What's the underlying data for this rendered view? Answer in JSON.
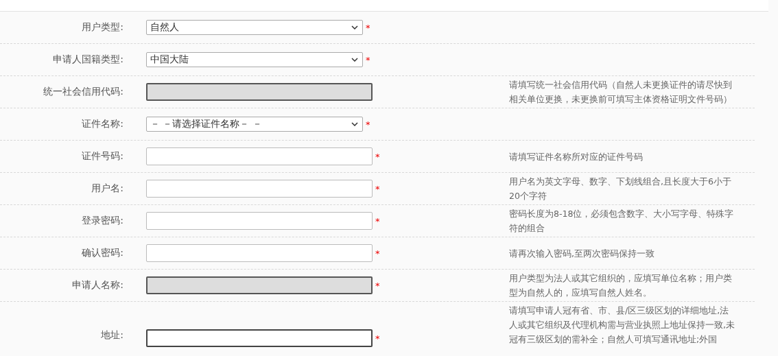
{
  "form": {
    "rows": [
      {
        "label": "用户类型:",
        "kind": "select",
        "value": "自然人",
        "disabled": false,
        "required_mark": "*"
      },
      {
        "label": "申请人国籍类型:",
        "kind": "select",
        "value": "中国大陆",
        "disabled": false,
        "required_mark": "*"
      },
      {
        "label": "统一社会信用代码:",
        "kind": "input",
        "disabled": true,
        "hint": "请填写统一社会信用代码（自然人未更换证件的请尽快到相关单位更换，未更换前可填写主体资格证明文件号码）"
      },
      {
        "label": "证件名称:",
        "kind": "select",
        "value": "－ －请选择证件名称－ －",
        "disabled": false,
        "required_mark": "*"
      },
      {
        "label": "证件号码:",
        "kind": "input",
        "disabled": false,
        "required_mark": "*",
        "hint": "请填写证件名称所对应的证件号码"
      },
      {
        "label": "用户名:",
        "kind": "input",
        "disabled": false,
        "required_mark": "*",
        "hint": "用户名为英文字母、数字、下划线组合,且长度大于6小于20个字符"
      },
      {
        "label": "登录密码:",
        "kind": "input",
        "disabled": false,
        "required_mark": "*",
        "hint": "密码长度为8-18位，必须包含数字、大小写字母、特殊字符的组合"
      },
      {
        "label": "确认密码:",
        "kind": "input",
        "disabled": false,
        "required_mark": "*",
        "hint": "请再次输入密码,至两次密码保持一致"
      },
      {
        "label": "申请人名称:",
        "kind": "input",
        "disabled": true,
        "required_mark": "*",
        "hint": "用户类型为法人或其它组织的，应填写单位名称；用户类型为自然人的，应填写自然人姓名。"
      },
      {
        "label": "地址:",
        "kind": "input",
        "disabled": false,
        "required_mark": "*",
        "hint": "请填写申请人冠有省、市、县/区三级区划的详细地址,法人或其它组织及代理机构需与营业执照上地址保持一致,未冠有三级区划的需补全；自然人可填写通讯地址;外国"
      }
    ]
  }
}
